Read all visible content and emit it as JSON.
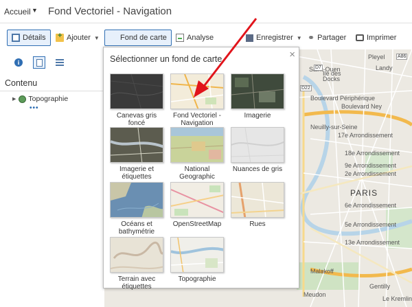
{
  "header": {
    "home_label": "Accueil",
    "home_caret": "▼",
    "title": "Fond Vectoriel - Navigation"
  },
  "toolbar": {
    "details": "Détails",
    "add": "Ajouter",
    "basemap": "Fond de carte",
    "analysis": "Analyse",
    "save": "Enregistrer",
    "share": "Partager",
    "print": "Imprimer"
  },
  "sidebar": {
    "content_title": "Contenu",
    "layer": "Topographie",
    "layer_more": "•••"
  },
  "gallery": {
    "title": "Sélectionner un fond de carte",
    "close": "×",
    "items": [
      {
        "label": "Canevas gris foncé"
      },
      {
        "label": "Fond Vectoriel - Navigation"
      },
      {
        "label": "Imagerie"
      },
      {
        "label": "Imagerie et étiquettes"
      },
      {
        "label": "National Geographic"
      },
      {
        "label": "Nuances de gris"
      },
      {
        "label": "Océans et bathymétrie"
      },
      {
        "label": "OpenStreetMap"
      },
      {
        "label": "Rues"
      },
      {
        "label": "Terrain avec étiquettes"
      },
      {
        "label": "Topographie"
      }
    ]
  },
  "map": {
    "labels": [
      {
        "id": "st-ouen",
        "text": "Saint-Ouen"
      },
      {
        "id": "landy",
        "text": "Landy"
      },
      {
        "id": "docks",
        "text": "Docks"
      },
      {
        "id": "ile-des",
        "text": "Ile des"
      },
      {
        "id": "pleyel",
        "text": "Pleyel"
      },
      {
        "id": "boulevard",
        "text": "Boulevard Périphérique"
      },
      {
        "id": "boulevard-ney",
        "text": "Boulevard Ney"
      },
      {
        "id": "neuilly",
        "text": "Neuilly-sur-Seine"
      },
      {
        "id": "arr17",
        "text": "17e Arrondissement"
      },
      {
        "id": "arr18",
        "text": "18e Arrondissement"
      },
      {
        "id": "arr9",
        "text": "9e Arrondissement"
      },
      {
        "id": "arr2",
        "text": "2e Arrondissement"
      },
      {
        "id": "paris",
        "text": "PARIS"
      },
      {
        "id": "arr6",
        "text": "6e Arrondissement"
      },
      {
        "id": "arr5",
        "text": "5e Arrondissement"
      },
      {
        "id": "arr13",
        "text": "13e Arrondissement"
      },
      {
        "id": "malakoff",
        "text": "Malakoff"
      },
      {
        "id": "gentilly",
        "text": "Gentilly"
      },
      {
        "id": "meudon",
        "text": "Meudon"
      },
      {
        "id": "kremlin",
        "text": "Le Kremlin"
      }
    ],
    "shields": [
      {
        "id": "d7",
        "text": "D7"
      },
      {
        "id": "d22",
        "text": "D22"
      },
      {
        "id": "a86",
        "text": "A86"
      }
    ]
  },
  "colors": {
    "accent": "#2f6eb3",
    "active_bg": "#e7f0fb",
    "arrow": "#e1141b",
    "map_bg": "#ece9e2"
  }
}
